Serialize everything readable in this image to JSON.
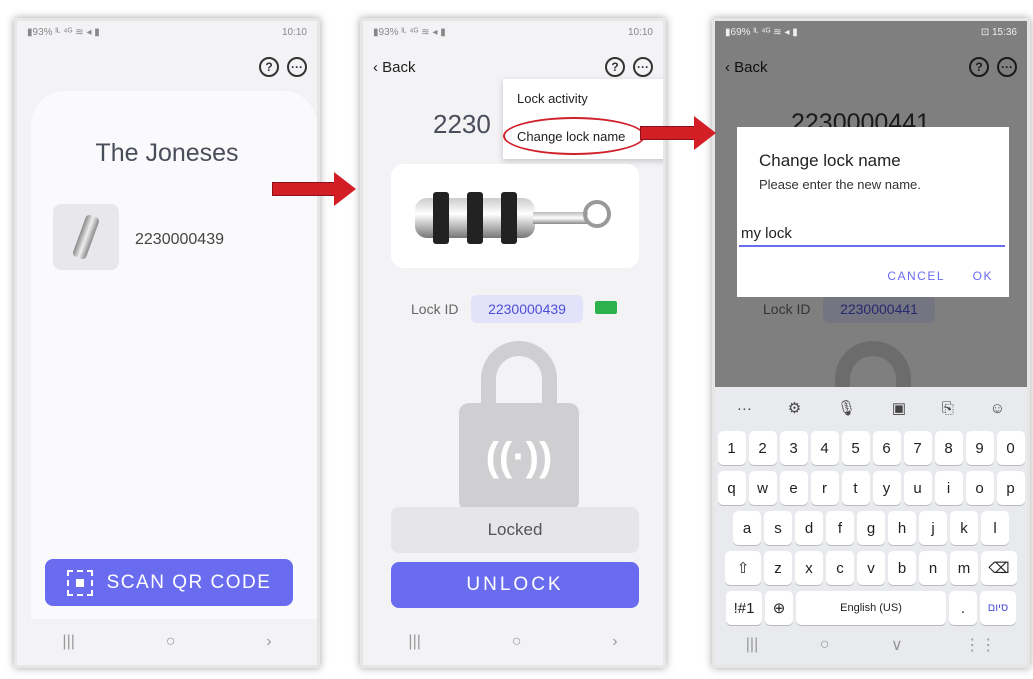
{
  "screen1": {
    "status_left": "▮93% ᴵᴸ ⁴ᴳ ≋ ◂ ▮",
    "status_time": "10:10",
    "group_name": "The Joneses",
    "lock_serial": "2230000439",
    "scan_button_label": "SCAN QR CODE",
    "nav": [
      "|||",
      "○",
      "›"
    ]
  },
  "screen2": {
    "status_left": "▮93% ᴵᴸ ⁴ᴳ ≋ ◂ ▮",
    "status_time": "10:10",
    "back_label": "‹ Back",
    "serial_partial": "2230",
    "menu_items": [
      "Lock activity",
      "Change lock name"
    ],
    "lock_id_label": "Lock ID",
    "lock_id_value": "2230000439",
    "lock_status": "Locked",
    "unlock_button_label": "UNLOCK",
    "nav": [
      "|||",
      "○",
      "›"
    ]
  },
  "screen3": {
    "status_left": "▮69% ᴵᴸ ⁴ᴳ ≋ ◂ ▮",
    "status_time": "⊡ 15:36",
    "back_label": "‹ Back",
    "serial": "2230000441",
    "lock_id_label": "Lock ID",
    "lock_id_value": "2230000441",
    "dialog": {
      "title": "Change lock name",
      "subtitle": "Please enter the new name.",
      "input_value": "my lock",
      "cancel_label": "CANCEL",
      "ok_label": "OK"
    },
    "keyboard": {
      "tools": [
        "···",
        "⚙",
        "🎙",
        "▣",
        "⎘",
        "☺"
      ],
      "row1": [
        "1",
        "2",
        "3",
        "4",
        "5",
        "6",
        "7",
        "8",
        "9",
        "0"
      ],
      "row2": [
        "q",
        "w",
        "e",
        "r",
        "t",
        "y",
        "u",
        "i",
        "o",
        "p"
      ],
      "row3": [
        "a",
        "s",
        "d",
        "f",
        "g",
        "h",
        "j",
        "k",
        "l"
      ],
      "row4": [
        "⇧",
        "z",
        "x",
        "c",
        "v",
        "b",
        "n",
        "m",
        "⌫"
      ],
      "symbols_key": "!#1",
      "globe_key": "⊕",
      "space_label": "English (US)",
      "period_key": ".",
      "lang_key": "סיום"
    },
    "nav": [
      "|||",
      "○",
      "∨",
      "⋮⋮"
    ]
  },
  "colors": {
    "accent": "#6a6cf0",
    "arrow": "#d41e26",
    "battery": "#2bb24c"
  },
  "icons": {
    "help": "question-circle-icon",
    "more": "ellipsis-circle-icon"
  }
}
